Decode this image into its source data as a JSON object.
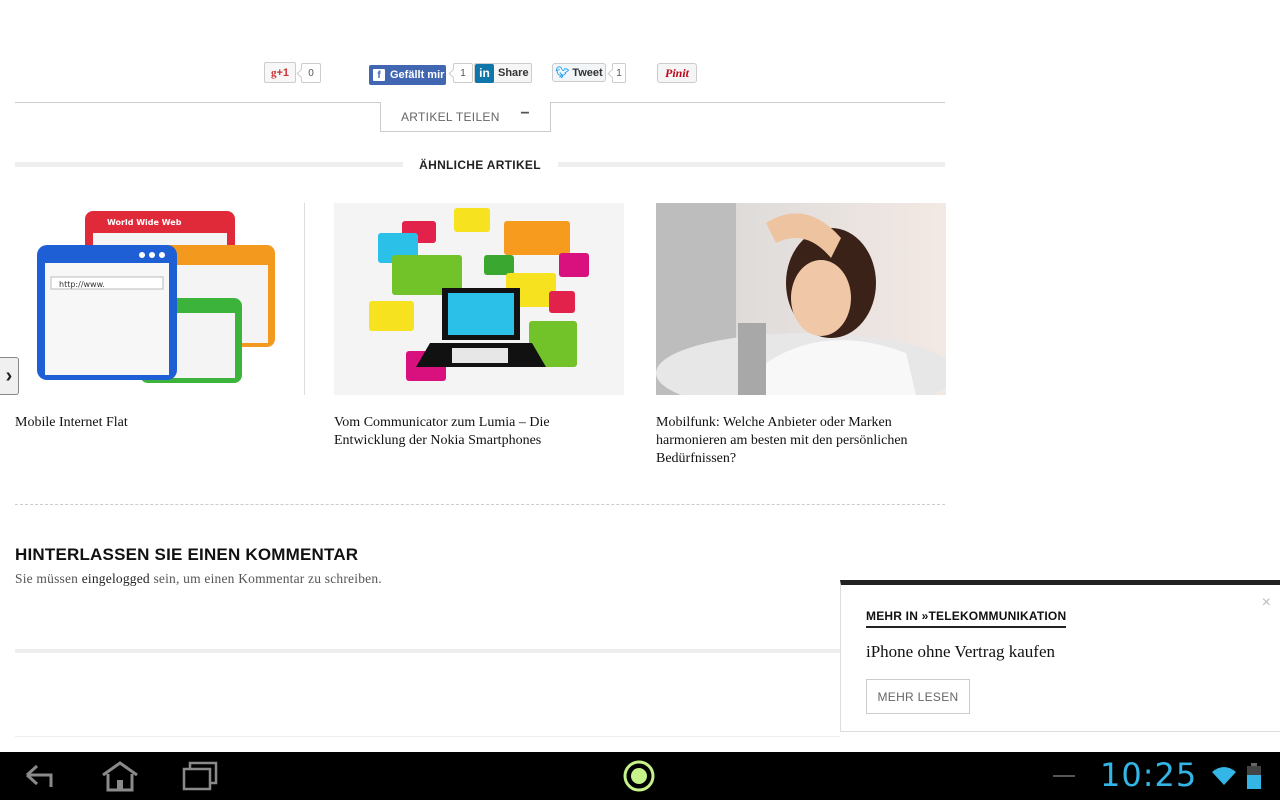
{
  "share": {
    "gplus_label": "+1",
    "gplus_count": "0",
    "facebook_label": "Gefällt mir",
    "facebook_count": "1",
    "linkedin_label": "Share",
    "twitter_label": "Tweet",
    "twitter_count": "1",
    "pinterest_label": "Pinit",
    "toggle_label": "ARTIKEL TEILEN",
    "toggle_symbol": "−"
  },
  "similar": {
    "heading": "ÄHNLICHE ARTIKEL",
    "items": [
      {
        "title": "Mobile Internet Flat"
      },
      {
        "title": "Vom Communicator zum Lumia – Die Entwicklung der Nokia Smartphones"
      },
      {
        "title": "Mobilfunk: Welche Anbieter oder Marken harmonieren am besten mit den persönlichen Bedürfnissen?"
      }
    ],
    "thumb1_text": {
      "window_title": "World Wide Web",
      "url": "http://www."
    }
  },
  "comments": {
    "heading": "HINTERLASSEN SIE EINEN KOMMENTAR",
    "note_before": "Sie müssen ",
    "note_link": "eingelogged",
    "note_after": " sein, um einen Kommentar zu schreiben."
  },
  "popup": {
    "kicker": "MEHR IN »TELEKOMMUNIKATION",
    "title": "iPhone ohne Vertrag kaufen",
    "button": "MEHR LESEN",
    "close": "×"
  },
  "statusbar": {
    "time": "10:25"
  },
  "colors": {
    "facebook": "#4267b2",
    "linkedin": "#0e76a8",
    "twitter": "#1da1f2",
    "pinterest": "#bd081c",
    "android_accent": "#33b5e5"
  }
}
